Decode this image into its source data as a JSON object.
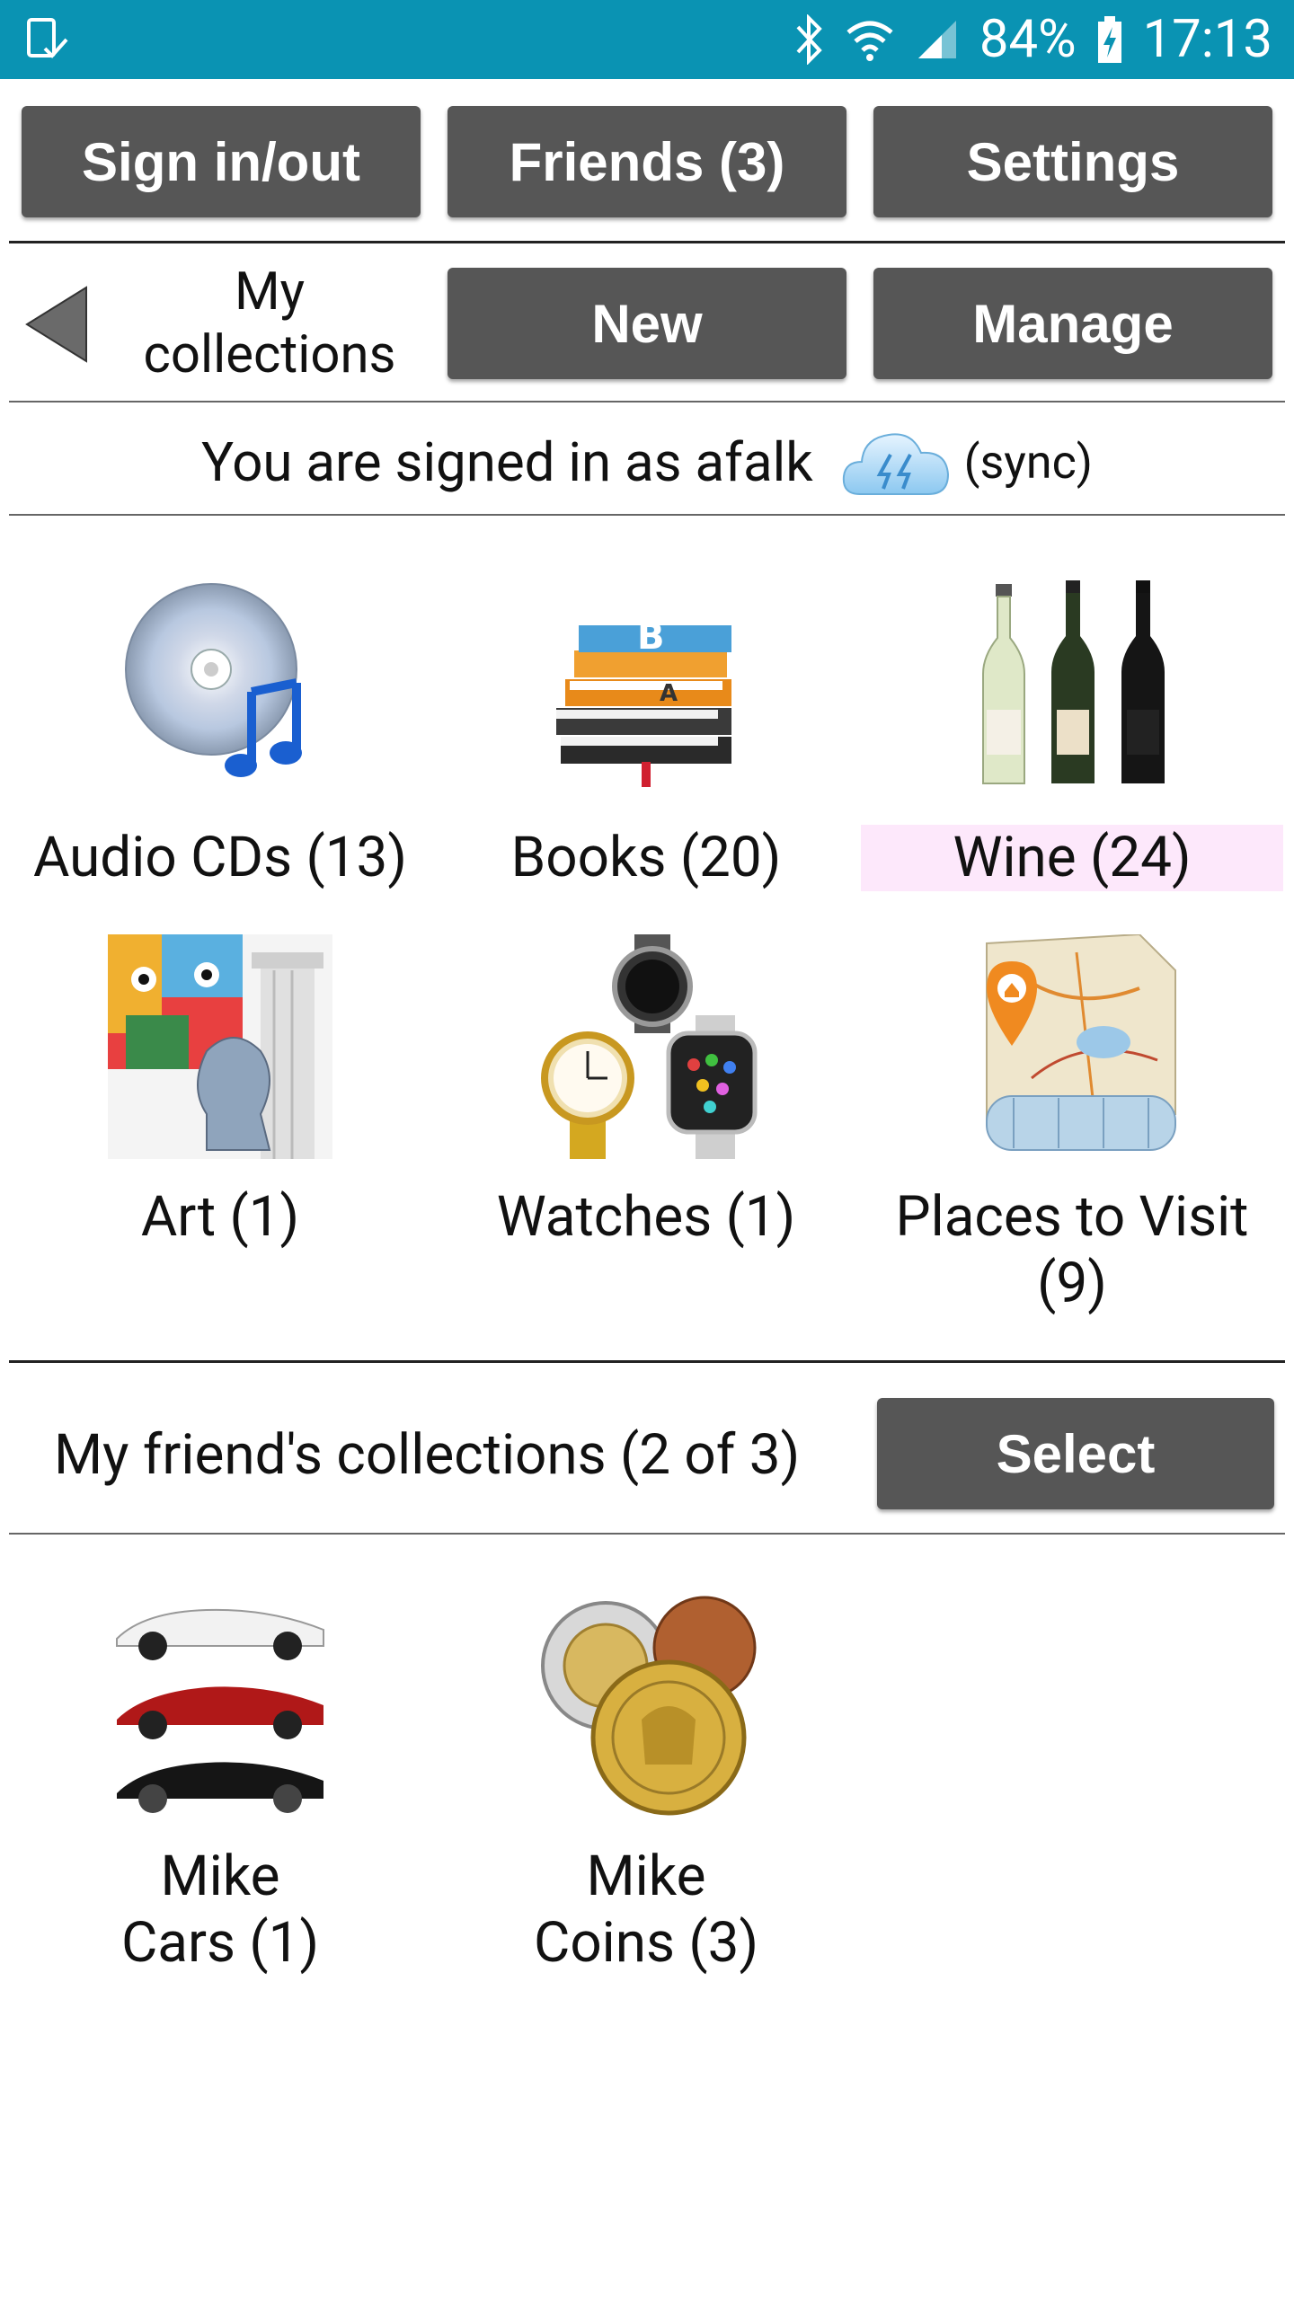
{
  "status_bar": {
    "battery": "84%",
    "time": "17:13"
  },
  "top_buttons": {
    "sign_in_out": "Sign in/out",
    "friends": "Friends (3)",
    "settings": "Settings"
  },
  "nav": {
    "title_line1": "My",
    "title_line2": "collections",
    "new_label": "New",
    "manage_label": "Manage"
  },
  "signin": {
    "text": "You are signed in as afalk",
    "sync_label": "(sync)"
  },
  "my_collections": [
    {
      "label": "Audio CDs (13)",
      "icon": "audio-cd-icon"
    },
    {
      "label": "Books (20)",
      "icon": "books-icon"
    },
    {
      "label": "Wine (24)",
      "icon": "wine-bottles-icon",
      "highlighted": true
    },
    {
      "label": "Art (1)",
      "icon": "art-icon"
    },
    {
      "label": "Watches (1)",
      "icon": "watches-icon"
    },
    {
      "label_line1": "Places to Visit",
      "label_line2": "(9)",
      "icon": "map-icon"
    }
  ],
  "friends_section": {
    "label": "My friend's collections (2 of 3)",
    "select_label": "Select",
    "collections": [
      {
        "label_line1": "Mike",
        "label_line2": "Cars (1)",
        "icon": "cars-icon"
      },
      {
        "label_line1": "Mike",
        "label_line2": "Coins (3)",
        "icon": "coins-icon"
      }
    ]
  },
  "colors": {
    "status_bar": "#0a93b3",
    "button": "#565656",
    "highlight": "#fde8fb"
  }
}
